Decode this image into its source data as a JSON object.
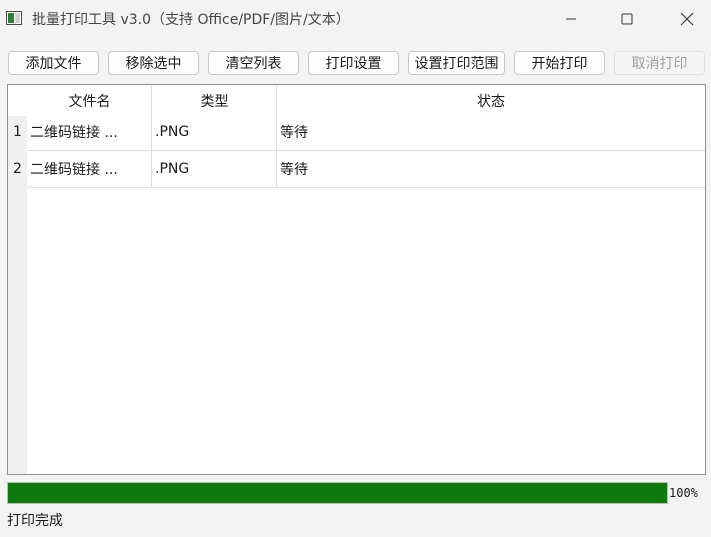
{
  "window": {
    "title": "批量打印工具 v3.0（支持 Office/PDF/图片/文本）",
    "icon": "app-icon"
  },
  "toolbar": {
    "buttons": [
      {
        "label": "添加文件",
        "enabled": true
      },
      {
        "label": "移除选中",
        "enabled": true
      },
      {
        "label": "清空列表",
        "enabled": true
      },
      {
        "label": "打印设置",
        "enabled": true
      },
      {
        "label": "设置打印范围",
        "enabled": true
      },
      {
        "label": "开始打印",
        "enabled": true
      },
      {
        "label": "取消打印",
        "enabled": false
      }
    ]
  },
  "table": {
    "columns": [
      "文件名",
      "类型",
      "状态"
    ],
    "rows": [
      {
        "index": "1",
        "name": "二维码链接 ...",
        "type": ".PNG",
        "status": "等待"
      },
      {
        "index": "2",
        "name": "二维码链接 ...",
        "type": ".PNG",
        "status": "等待"
      }
    ]
  },
  "progress": {
    "value": 100,
    "text": "100%",
    "color": "#0e7a0d"
  },
  "status_bar": {
    "text": "打印完成"
  }
}
